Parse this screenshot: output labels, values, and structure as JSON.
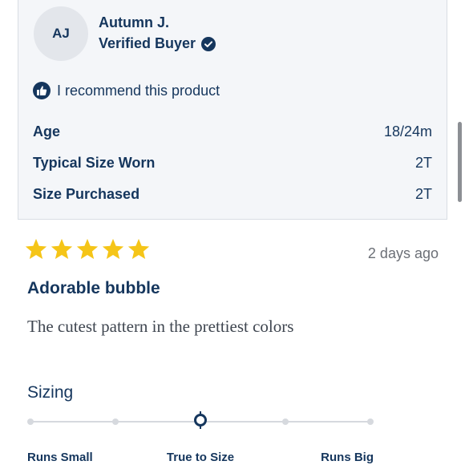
{
  "reviewer": {
    "initials": "AJ",
    "name": "Autumn J.",
    "badge": "Verified Buyer",
    "badge_icon": "verified-check-icon"
  },
  "recommend": {
    "icon": "thumbs-up-icon",
    "text": "I recommend this product"
  },
  "attributes": [
    {
      "label": "Age",
      "value": "18/24m"
    },
    {
      "label": "Typical Size Worn",
      "value": "2T"
    },
    {
      "label": "Size Purchased",
      "value": "2T"
    }
  ],
  "review": {
    "rating": 5,
    "max_rating": 5,
    "date": "2 days ago",
    "title": "Adorable bubble",
    "body": "The cutest pattern in the prettiest colors"
  },
  "sizing": {
    "label": "Sizing",
    "positions": 5,
    "selected_index": 2,
    "scale_labels": [
      "Runs Small",
      "True to Size",
      "Runs Big"
    ]
  },
  "colors": {
    "primary": "#15365d",
    "star": "#f5c518",
    "card_bg": "#f4f6f9",
    "muted": "#6b6f76"
  }
}
